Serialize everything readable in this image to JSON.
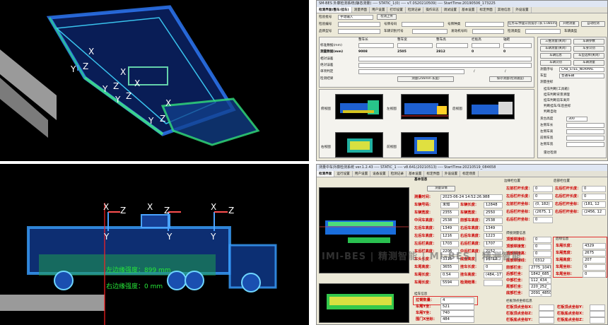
{
  "top_left": {
    "axis_labels": [
      "X",
      "Y",
      "Z",
      "X",
      "Y",
      "Z",
      "X",
      "Y",
      "Z",
      "X",
      "Y",
      "Z"
    ]
  },
  "bottom_left": {
    "axis_labels": [
      "X",
      "Z",
      "Y",
      "X",
      "Z",
      "Y",
      "X",
      "Z",
      "Y"
    ],
    "overlay_line1": "左边缘强度：899 mm",
    "overlay_line2": "右边缘强度：0 mm"
  },
  "top_right": {
    "title": "SM-BES 外廓检测系统(静态测量) ---- STATIC_1(0) ---- v7.0S20210509) ---- StartTime:20190506_173225",
    "tabs": [
      "检测界面(整车/挂车)",
      "测量界面",
      "用户设置",
      "打印设置",
      "检测记录",
      "操作日志",
      "调试设置",
      "基本设置",
      "标定界面",
      "其他信息",
      "外设设置"
    ],
    "form": {
      "row1": [
        {
          "label": "检验批号",
          "value": "手动输入"
        },
        {
          "label": "",
          "value": "检测上传"
        }
      ],
      "row2": [
        {
          "label": "检验编号",
          "value": ""
        },
        {
          "label": "号牌号码",
          "value": ""
        },
        {
          "label": "号牌种类",
          "value": ""
        },
        {
          "label": "",
          "value": "自动识别"
        }
      ],
      "row3": [
        {
          "label": "品牌型号",
          "value": ""
        },
        {
          "label": "车辆识别代号",
          "value": ""
        },
        {
          "label": "发动机号码",
          "value": ""
        },
        {
          "label": "检测类型",
          "value": ""
        }
      ],
      "btn_left": "任务车/界面识别提示 (长 5.085m)",
      "btn_mid": "开始测量",
      "btn_right": "自动检测",
      "car_type": "车辆类型"
    },
    "table_headers": [
      "整车长",
      "整车宽",
      "整车高",
      "栏板高",
      "轴距"
    ],
    "table_rows": [
      {
        "label": "标准数据(mm)",
        "values": [
          "",
          "",
          "",
          "",
          ""
        ]
      },
      {
        "label": "测量数据(mm)",
        "values": [
          "9008",
          "2505",
          "2812",
          "0",
          "0"
        ]
      },
      {
        "label": "相对误差",
        "values": [
          "",
          "",
          "",
          "",
          ""
        ]
      },
      {
        "label": "绝对误差",
        "values": [
          "",
          "",
          "",
          "",
          ""
        ]
      },
      {
        "label": "单项判定",
        "values": [
          "",
          "",
          "",
          "/",
          "/"
        ]
      },
      {
        "label": "检测结果",
        "values": [
          "",
          "",
          "",
          "",
          ""
        ]
      }
    ],
    "center_btn": "测量(256mm 长度)",
    "right_small_btn": "保存测量(检测速度)",
    "thumb_labels": [
      "俯视图",
      "左视图",
      "后视图",
      "右视图",
      "前视图",
      "后视图"
    ],
    "right_buttons": [
      "三维测量(关闭)",
      "车辆参数",
      "车辆测量(关闭)",
      "车身识别",
      "车辆信息",
      "车型选择(关闭)",
      "车辆识别",
      "车辆测量"
    ],
    "right_labels": [
      "测量序号",
      "车型",
      "测量坐标",
      "",
      "货台高度",
      "左侧车长",
      "左侧车高",
      "前侧车宽",
      "左侧车宽",
      "后侧车宽",
      "整体车长",
      "整体车高",
      "整体车宽",
      "侧面长度"
    ],
    "checkboxes": [
      "挂车判断[工具箱]",
      "挂车判断背景清理",
      "挂车判断前车离开",
      "判断挂车/车后坐标",
      "判断自动",
      "雷达检测"
    ],
    "model_value": "CAB_STEE_NORMAL",
    "type_value": "普通车辆",
    "height_value": "300",
    "list_values": [
      "",
      "",
      "",
      "",
      "",
      "",
      "",
      ""
    ]
  },
  "bottom_right": {
    "title": "测量中车外廓检测系统 ver.1.2.43 ---- STATIC_1 ---- v8.641(20210513) ---- StartTime:20210519_084658",
    "tabs": [
      "检测界面",
      "运行设置",
      "用户设置",
      "设备设置",
      "检测记录",
      "基本设置",
      "标定界面",
      "外设设置",
      "标定场景"
    ],
    "panel_title": "基本信息",
    "preview_btn": "测量详情",
    "right_header_a": "边缘栏位置",
    "right_header_b": "后部栏位置",
    "rows": [
      {
        "k": "测量时间：",
        "v": "2023-06-24 14:52:26.988"
      },
      {
        "k": "车辆号码：",
        "v": "未知",
        "k2": "车辆长度：",
        "v2": "12848"
      },
      {
        "k": "车辆宽度：",
        "v": "2355",
        "k2": "车辆宽度：",
        "v2": "2550"
      },
      {
        "k": "中间车高度：",
        "v": "2538",
        "k2": "前部车高度：",
        "v2": "2538"
      },
      {
        "k": "左后车高度：",
        "v": "1349",
        "k2": "右后车高度：",
        "v2": "1349"
      },
      {
        "k": "左后车高度：",
        "v": "1216",
        "k2": "右后车高度：",
        "v2": "1223"
      },
      {
        "k": "左后栏高度：",
        "v": "1703",
        "k2": "右后栏高度：",
        "v2": "1707"
      },
      {
        "k": "车后栏高度：",
        "v": "2206",
        "k2": "中后栏高度：",
        "v2": "2152"
      },
      {
        "k": "车头长度：",
        "v": "3315",
        "k2": "底盘高度：",
        "v2": "10712"
      },
      {
        "k": "车尾高度：",
        "v": "3655",
        "k2": "挂车长度：",
        "v2": "0"
      },
      {
        "k": "车厢长度：",
        "v": "0.54",
        "k2": "挂车高度：",
        "v2": "(484,-17"
      },
      {
        "k": "车厢长度：",
        "v": "5594",
        "k2": "检测结果：",
        "v2": ""
      }
    ],
    "bottom_block": {
      "title": "挂车信息",
      "rows": [
        {
          "k": "拉臂数量：",
          "v": "4"
        },
        {
          "k": "车厢Y坐：",
          "v": "521"
        },
        {
          "k": "车厢Y坐：",
          "v": "740"
        },
        {
          "k": "围门X坐标：",
          "v": "484"
        }
      ]
    },
    "mid_rows": [
      {
        "k": "左前栏杆长度：",
        "v": "0"
      },
      {
        "k": "左后栏杆长度：",
        "v": "0"
      },
      {
        "k": "左前栏杆坐标：",
        "v": "(0, 182)"
      },
      {
        "k": "右后栏杆坐标：",
        "v": "(2675, 1"
      },
      {
        "k": "右后栏杆坐标：",
        "v": "0"
      }
    ],
    "far_rows": [
      {
        "k": "左后栏杆长度：",
        "v": "0"
      },
      {
        "k": "右后栏杆长度：",
        "v": "0"
      },
      {
        "k": "右后栏杆坐标：",
        "v": "(181, 12"
      },
      {
        "k": "右后栏杆坐标：",
        "v": "(2456, 12"
      }
    ],
    "weld_title": "焊接测量信息",
    "weld_rows": [
      {
        "k": "顶部焊接线：",
        "v": "0"
      },
      {
        "k": "顶部焊接宽：",
        "v": "0"
      },
      {
        "k": "顶部焊接高：",
        "v": "0"
      },
      {
        "k": "底部焊接线：",
        "v": "0312"
      }
    ],
    "red_box_title": "后喷信息",
    "red_box_rows": [
      {
        "k": "车厢长度：",
        "v": "4329"
      },
      {
        "k": "车厢宽度：",
        "v": "2675"
      },
      {
        "k": "车厢高度：",
        "v": "207"
      },
      {
        "k": "车尾坐标：",
        "v": "0"
      },
      {
        "k": "车尾坐标：",
        "v": "0"
      }
    ],
    "lower_rows": [
      {
        "k": "前部栏坐：",
        "v": "2775_1047"
      },
      {
        "k": "后部栏坐：",
        "v": "1842_685_"
      },
      {
        "k": "中部栏坐：",
        "v": "112_434_"
      },
      {
        "k": "尾部栏坐：",
        "v": "220_252_"
      },
      {
        "k": "底部栏坐：",
        "v": "2091_4850_"
      }
    ],
    "bottom_list_title": "栏板顶点坐标信息",
    "bottom_list": [
      "栏板顶点坐标X：",
      "栏板顶点坐标Y：",
      "栏板顶点坐标Z：",
      "栏板底点坐标X：",
      "栏板底点坐标Y：",
      "栏板底点坐标Z："
    ],
    "watermark": "IMI-BES | 精测智能 | MI-BES | 精测智能"
  }
}
